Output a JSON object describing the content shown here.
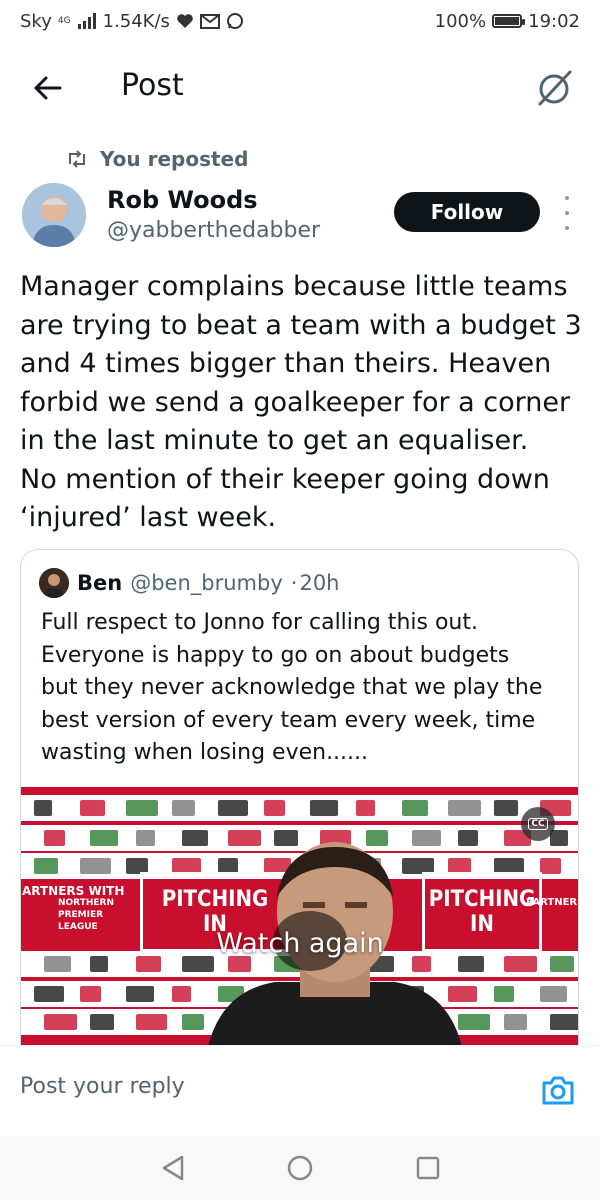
{
  "status_bar": {
    "carrier": "Sky",
    "network": "4G",
    "speed": "1.54K/s",
    "battery": "100%",
    "battery_level": 1.0,
    "time": "19:02",
    "icons": [
      "signal-icon",
      "heart-icon",
      "mail-icon",
      "whatsapp-icon",
      "battery-icon"
    ]
  },
  "header": {
    "title": "Post",
    "icons": [
      "back-arrow-icon",
      "grok-icon"
    ]
  },
  "repost": {
    "label": "You reposted",
    "icon": "repost-icon"
  },
  "author": {
    "name": "Rob Woods",
    "handle": "@yabberthedabber",
    "follow_label": "Follow"
  },
  "tweet": {
    "lines": [
      "Manager complains because little teams",
      "are trying to beat a team with a budget 3",
      "and 4 times bigger than theirs. Heaven",
      "forbid we send a goalkeeper for a corner",
      "in the last minute to get an equaliser.",
      "No mention of their keeper going down",
      "‘injured’ last week."
    ]
  },
  "quote": {
    "name": "Ben",
    "handle": "@ben_brumby",
    "separator": "·",
    "time": "20h",
    "lines": [
      "Full respect to Jonno for calling this out.",
      "Everyone is happy to go on about budgets",
      "but they never acknowledge that we play the",
      "best version of every team every week, time",
      "wasting when losing even......"
    ],
    "video": {
      "overlay_label": "Watch again",
      "cc_label": "CC",
      "board_text_left": [
        "PITCHING",
        "IN"
      ],
      "board_text_right": [
        "PITCHING",
        "IN"
      ],
      "partners_left": [
        "ARTNERS WITH",
        "NORTHERN",
        "PREMIER",
        "LEAGUE"
      ],
      "partners_right": [
        "PARTNERS"
      ],
      "colors": {
        "board_red": "#c8102e",
        "board_white": "#ffffff"
      }
    }
  },
  "reply": {
    "placeholder": "Post your reply",
    "icon": "camera-icon"
  },
  "nav_bar": {
    "icons": [
      "nav-back-icon",
      "nav-home-icon",
      "nav-recent-icon"
    ]
  },
  "colors": {
    "text_primary": "#0f1419",
    "text_secondary": "#536471",
    "accent": "#1d9bf0",
    "follow_bg": "#0f1419"
  }
}
